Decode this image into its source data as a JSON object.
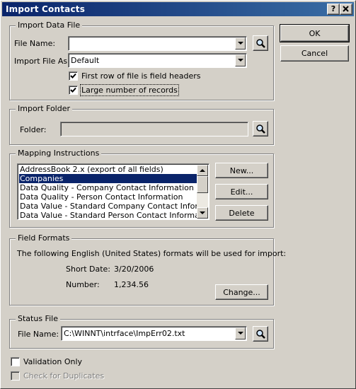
{
  "window": {
    "title": "Import Contacts",
    "help_label": "?",
    "close_label": "X"
  },
  "buttons": {
    "ok": "OK",
    "cancel": "Cancel",
    "new": "New...",
    "edit": "Edit...",
    "delete": "Delete",
    "change": "Change..."
  },
  "import_data_file": {
    "legend": "Import Data File",
    "file_name_label": "File Name:",
    "file_name_value": "",
    "import_as_label": "Import File As:",
    "import_as_value": "Default",
    "first_row_label": "First row of file is field headers",
    "first_row_checked": true,
    "large_records_label": "Large number of records",
    "large_records_checked": true
  },
  "import_folder": {
    "legend": "Import Folder",
    "folder_label": "Folder:",
    "folder_value": ""
  },
  "mapping": {
    "legend": "Mapping Instructions",
    "items": [
      "AddressBook 2.x (export of all fields)",
      "Companies",
      "Data Quality - Company Contact Information",
      "Data Quality - Person Contact Information",
      "Data Value - Standard Company Contact Information",
      "Data Value - Standard Person Contact Information"
    ],
    "selected_index": 1
  },
  "field_formats": {
    "legend": "Field Formats",
    "description": "The following English (United States) formats will be used for import:",
    "short_date_label": "Short Date:",
    "short_date_value": "3/20/2006",
    "number_label": "Number:",
    "number_value": "1,234.56"
  },
  "status_file": {
    "legend": "Status File",
    "file_name_label": "File Name:",
    "file_name_value": "C:\\WINNT\\intrface\\ImpErr02.txt"
  },
  "options": {
    "validation_only_label": "Validation Only",
    "validation_only_checked": false,
    "check_duplicates_label": "Check for Duplicates",
    "check_duplicates_checked": false
  },
  "icons": {
    "browse": "magnifier-icon",
    "check": "checkmark-icon"
  }
}
